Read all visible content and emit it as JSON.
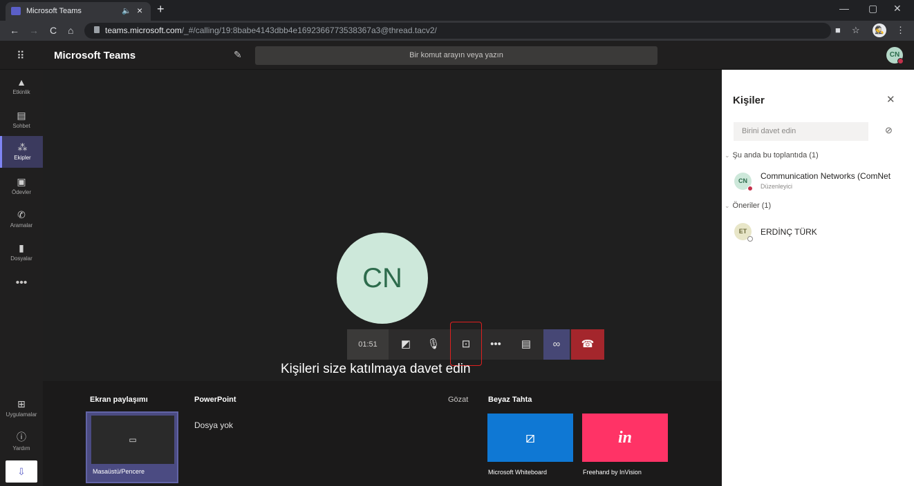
{
  "browser": {
    "tab_title": "Microsoft Teams",
    "tab_audio": "🔈",
    "tab_close": "×",
    "new_tab": "+",
    "url_host": "teams.microsoft.com",
    "url_path": "/_#/calling/19:8babe4143dbb4e1692366773538367a3@thread.tacv2/",
    "profile_initial": "🕵"
  },
  "teams": {
    "app_title": "Microsoft Teams",
    "search_placeholder": "Bir komut arayın veya yazın",
    "me_initials": "CN"
  },
  "rail": {
    "items": [
      {
        "label": "Etkinlik",
        "icon": "bell-icon"
      },
      {
        "label": "Sohbet",
        "icon": "chat-icon"
      },
      {
        "label": "Ekipler",
        "icon": "teams-icon"
      },
      {
        "label": "Ödevler",
        "icon": "assignments-icon"
      },
      {
        "label": "Aramalar",
        "icon": "phone-icon"
      },
      {
        "label": "Dosyalar",
        "icon": "file-icon"
      }
    ],
    "more": "•••",
    "apps_label": "Uygulamalar",
    "help_label": "Yardım"
  },
  "call": {
    "avatar_initials": "CN",
    "timer": "01:51",
    "invite_text": "Kişileri size katılmaya davet edin"
  },
  "tray": {
    "screen_share_title": "Ekran paylaşımı",
    "desktop_caption": "Masaüstü/Pencere",
    "powerpoint_title": "PowerPoint",
    "no_file": "Dosya yok",
    "browse": "Gözat",
    "whiteboard_title": "Beyaz Tahta",
    "ms_whiteboard": "Microsoft Whiteboard",
    "invision": "Freehand by InVision",
    "invision_logo": "in"
  },
  "people": {
    "title": "Kişiler",
    "invite_placeholder": "Birini davet edin",
    "in_meeting_section": "Şu anda bu toplantıda (1)",
    "participants": [
      {
        "initials": "CN",
        "name": "Communication Networks (ComNet",
        "role": "Düzenleyici"
      }
    ],
    "suggestions_section": "Öneriler (1)",
    "suggestions": [
      {
        "initials": "ET",
        "name": "ERDİNÇ TÜRK"
      }
    ]
  }
}
